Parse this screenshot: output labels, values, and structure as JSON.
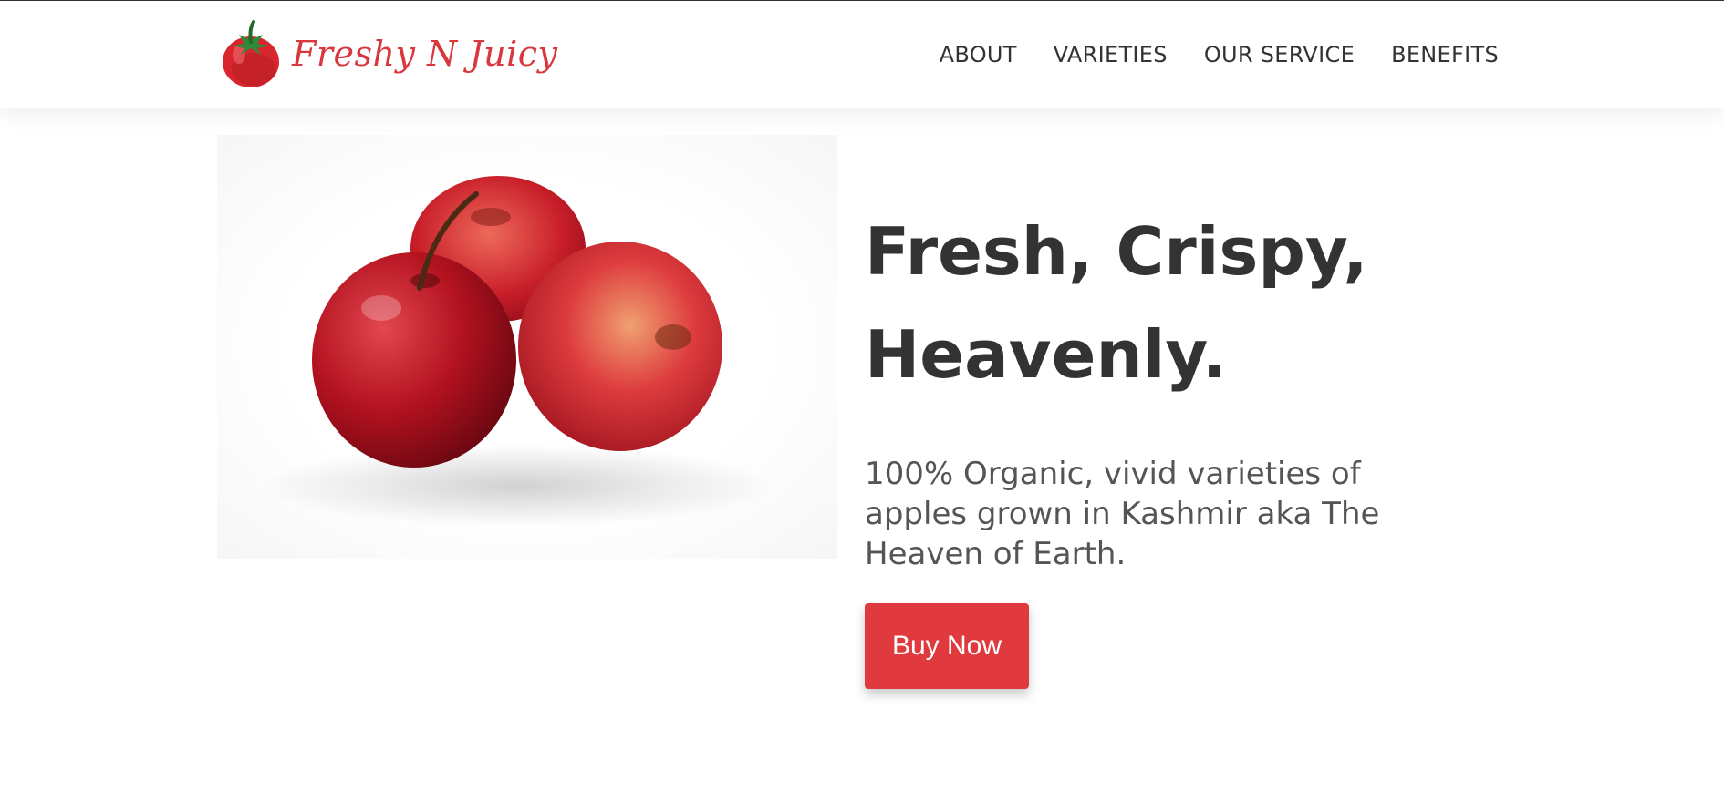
{
  "brand": {
    "name": "Freshy N Juicy",
    "logo_icon": "tomato-icon",
    "color": "#d9363e"
  },
  "nav": {
    "items": [
      {
        "label": "ABOUT"
      },
      {
        "label": "VARIETIES"
      },
      {
        "label": "OUR SERVICE"
      },
      {
        "label": "BENEFITS"
      }
    ]
  },
  "hero": {
    "image_icon": "apples-image",
    "title_line1": "Fresh, Crispy,",
    "title_line2": "Heavenly.",
    "subtitle": "100% Organic, vivid varieties of apples grown in Kashmir aka The Heaven of Earth.",
    "cta_label": "Buy Now",
    "cta_color": "#e0393e",
    "text_color": "#333333"
  }
}
